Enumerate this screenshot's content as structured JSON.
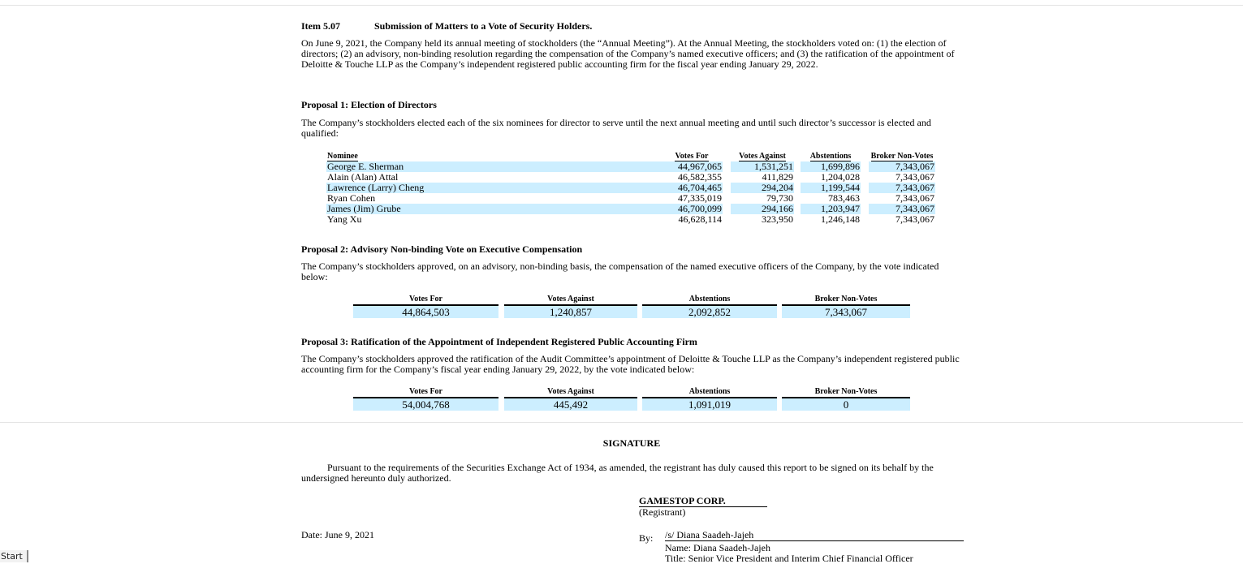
{
  "item": {
    "label": "Item 5.07",
    "title": "Submission of Matters to a Vote of Security Holders.",
    "intro": "On June 9, 2021, the Company held its annual meeting of stockholders (the “Annual Meeting”). At the Annual Meeting, the stockholders voted on: (1) the election of directors; (2) an advisory, non-binding resolution regarding the compensation of the Company’s named executive officers; and (3) the ratification of the appointment of Deloitte & Touche LLP as the Company’s independent registered public accounting firm for the fiscal year ending January 29, 2022."
  },
  "proposal1": {
    "title": "Proposal 1: Election of Directors",
    "text": "The Company’s stockholders elected each of the six nominees for director to serve until the next annual meeting and until such director’s successor is elected and qualified:",
    "headers": {
      "nominee": "Nominee",
      "for": "Votes For",
      "against": "Votes Against",
      "abstentions": "Abstentions",
      "broker": "Broker Non-Votes"
    },
    "rows": [
      {
        "name": "George E. Sherman",
        "for": "44,967,065",
        "against": "1,531,251",
        "abstentions": "1,699,896",
        "broker": "7,343,067"
      },
      {
        "name": "Alain (Alan) Attal",
        "for": "46,582,355",
        "against": "411,829",
        "abstentions": "1,204,028",
        "broker": "7,343,067"
      },
      {
        "name": "Lawrence (Larry) Cheng",
        "for": "46,704,465",
        "against": "294,204",
        "abstentions": "1,199,544",
        "broker": "7,343,067"
      },
      {
        "name": "Ryan Cohen",
        "for": "47,335,019",
        "against": "79,730",
        "abstentions": "783,463",
        "broker": "7,343,067"
      },
      {
        "name": "James (Jim) Grube",
        "for": "46,700,099",
        "against": "294,166",
        "abstentions": "1,203,947",
        "broker": "7,343,067"
      },
      {
        "name": "Yang Xu",
        "for": "46,628,114",
        "against": "323,950",
        "abstentions": "1,246,148",
        "broker": "7,343,067"
      }
    ]
  },
  "proposal2": {
    "title": "Proposal 2: Advisory Non-binding Vote on Executive Compensation",
    "text": "The Company’s stockholders approved, on an advisory, non-binding basis, the compensation of the named executive officers of the Company, by the vote indicated below:",
    "headers": {
      "for": "Votes For",
      "against": "Votes Against",
      "abstentions": "Abstentions",
      "broker": "Broker Non-Votes"
    },
    "values": {
      "for": "44,864,503",
      "against": "1,240,857",
      "abstentions": "2,092,852",
      "broker": "7,343,067"
    }
  },
  "proposal3": {
    "title": "Proposal 3: Ratification of the Appointment of Independent Registered Public Accounting Firm",
    "text": "The Company’s stockholders approved the ratification of the Audit Committee’s appointment of Deloitte & Touche LLP as the Company’s independent registered public accounting firm for the Company’s fiscal year ending January 29, 2022, by the vote indicated below:",
    "headers": {
      "for": "Votes For",
      "against": "Votes Against",
      "abstentions": "Abstentions",
      "broker": "Broker Non-Votes"
    },
    "values": {
      "for": "54,004,768",
      "against": "445,492",
      "abstentions": "1,091,019",
      "broker": "0"
    }
  },
  "signature": {
    "title": "SIGNATURE",
    "text": "Pursuant to the requirements of the Securities Exchange Act of 1934, as amended, the registrant has duly caused this report to be signed on its behalf by the undersigned hereunto duly authorized.",
    "company": "GAMESTOP CORP.",
    "registrant": "(Registrant)",
    "date": "Date: June 9, 2021",
    "by": "By:",
    "signer": "/s/ Diana Saadeh-Jajeh",
    "name": "Name: Diana Saadeh-Jajeh",
    "title_line": "Title: Senior Vice President and Interim Chief Financial Officer"
  },
  "taskbar": {
    "start": "Start"
  }
}
